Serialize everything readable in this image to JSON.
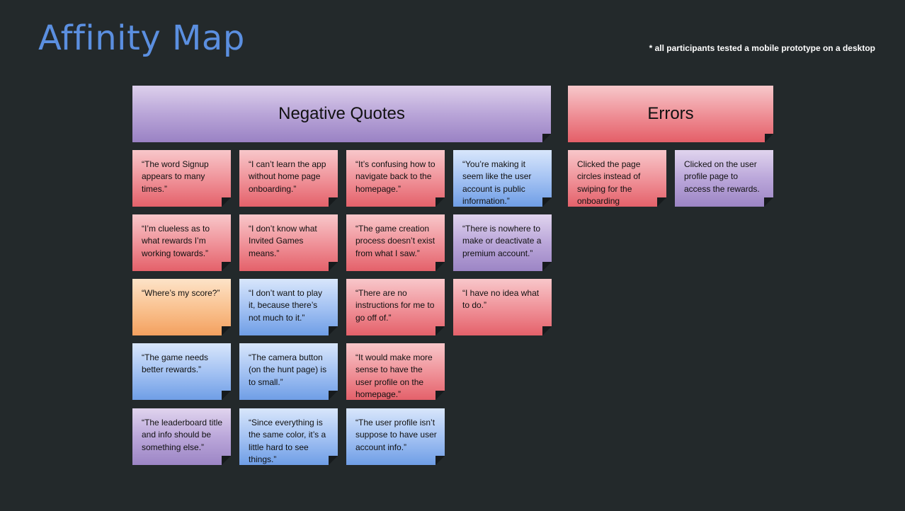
{
  "title": "Affinity Map",
  "footnote": "* all participants tested a mobile prototype on a desktop",
  "groups": {
    "negative": {
      "header": "Negative Quotes",
      "notes": [
        {
          "text": "“The word Signup appears to many times.”",
          "color": "pink"
        },
        {
          "text": "“I can’t learn the app without home page onboarding.”",
          "color": "pink"
        },
        {
          "text": "“It’s confusing how to navigate back to the homepage.”",
          "color": "pink"
        },
        {
          "text": "“You’re making it seem like the user account is public information.”",
          "color": "blue"
        },
        {
          "text": "“I’m clueless as to what rewards I’m working towards.”",
          "color": "pink"
        },
        {
          "text": "“I don’t know what Invited Games means.”",
          "color": "pink"
        },
        {
          "text": "“The game creation process doesn’t exist from what I saw.”",
          "color": "pink"
        },
        {
          "text": "“There is nowhere to make or deactivate a premium account.”",
          "color": "purple"
        },
        {
          "text": "“Where’s my score?”",
          "color": "orange"
        },
        {
          "text": "“I don’t want to play it, because there’s not much to it.”",
          "color": "blue"
        },
        {
          "text": "“There are no instructions for me to go off of.”",
          "color": "pink"
        },
        {
          "text": "“I have no idea what to do.”",
          "color": "pink"
        },
        {
          "text": "“The game needs better rewards.”",
          "color": "blue"
        },
        {
          "text": "“The camera button (on the hunt page) is to small.”",
          "color": "blue"
        },
        {
          "text": "“It would make more sense to have the user profile on the homepage.”",
          "color": "pink"
        },
        {
          "text": "“The leaderboard title and info should be something else.”",
          "color": "purple"
        },
        {
          "text": "“Since everything is the same color, it’s a little hard to see things.”",
          "color": "blue"
        },
        {
          "text": "“The user profile isn’t suppose to have user account info.”",
          "color": "blue"
        }
      ]
    },
    "errors": {
      "header": "Errors",
      "notes": [
        {
          "text": "Clicked the page circles instead of swiping for the onboarding",
          "color": "pink"
        },
        {
          "text": "Clicked on the user profile page to access the rewards.",
          "color": "purple"
        }
      ]
    }
  }
}
